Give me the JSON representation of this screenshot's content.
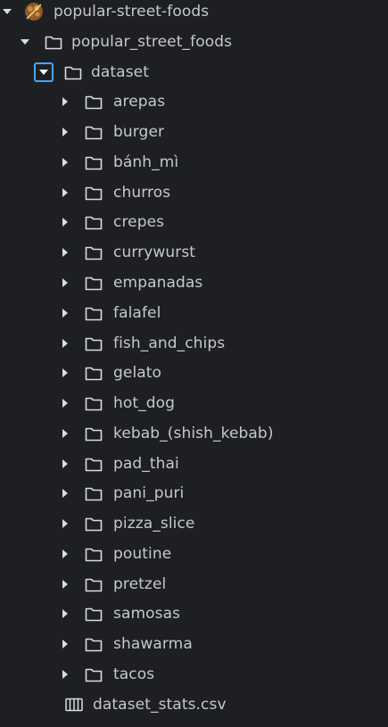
{
  "root": {
    "label": "popular-street-foods",
    "logo_icon": "street-food-logo-icon"
  },
  "folder_1": {
    "label": "popular_street_foods"
  },
  "folder_2": {
    "label": "dataset"
  },
  "items": [
    {
      "label": "arepas"
    },
    {
      "label": "burger"
    },
    {
      "label": "bánh_mì"
    },
    {
      "label": "churros"
    },
    {
      "label": "crepes"
    },
    {
      "label": "currywurst"
    },
    {
      "label": "empanadas"
    },
    {
      "label": "falafel"
    },
    {
      "label": "fish_and_chips"
    },
    {
      "label": "gelato"
    },
    {
      "label": "hot_dog"
    },
    {
      "label": "kebab_(shish_kebab)"
    },
    {
      "label": "pad_thai"
    },
    {
      "label": "pani_puri"
    },
    {
      "label": "pizza_slice"
    },
    {
      "label": "poutine"
    },
    {
      "label": "pretzel"
    },
    {
      "label": "samosas"
    },
    {
      "label": "shawarma"
    },
    {
      "label": "tacos"
    }
  ],
  "file": {
    "label": "dataset_stats.csv",
    "icon": "csv-table-icon"
  },
  "colors": {
    "background": "#1e1f22",
    "text": "#c5c8cc",
    "focus_ring": "#4aa3ff"
  }
}
